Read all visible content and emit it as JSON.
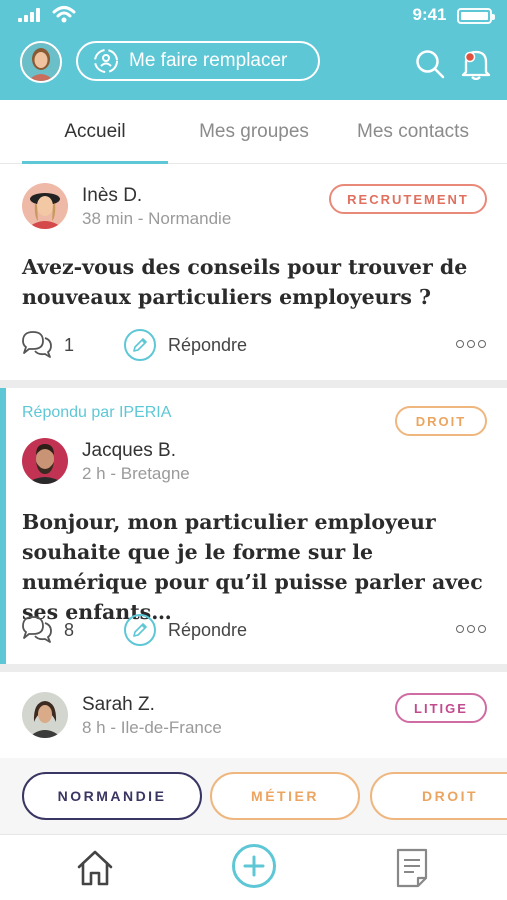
{
  "status_bar": {
    "time": "9:41"
  },
  "header": {
    "replace_button_label": "Me faire remplacer"
  },
  "tabs": [
    {
      "label": "Accueil",
      "active": true
    },
    {
      "label": "Mes groupes",
      "active": false
    },
    {
      "label": "Mes contacts",
      "active": false
    }
  ],
  "posts": [
    {
      "author": "Inès D.",
      "meta": "38 min - Normandie",
      "badge": "RECRUTEMENT",
      "question": "Avez-vous des conseils pour trouver de nouveaux particuliers employeurs ?",
      "comments": "1",
      "reply_label": "Répondre"
    },
    {
      "answered_by": "Répondu par IPERIA",
      "author": "Jacques B.",
      "meta": "2 h - Bretagne",
      "badge": "DROIT",
      "question": "Bonjour, mon particulier employeur souhaite que je le forme sur le numérique pour qu’il puisse parler avec ses enfants…",
      "comments": "8",
      "reply_label": "Répondre"
    },
    {
      "author": "Sarah Z.",
      "meta": "8 h - Ile-de-France",
      "badge": "LITIGE"
    }
  ],
  "filters": [
    "NORMANDIE",
    "MÉTIER",
    "DROIT"
  ],
  "colors": {
    "accent": "#5ec7d6",
    "recrutement": "#e0705f",
    "droit": "#eba560",
    "litige": "#c24a8e",
    "navy": "#3a3663"
  }
}
